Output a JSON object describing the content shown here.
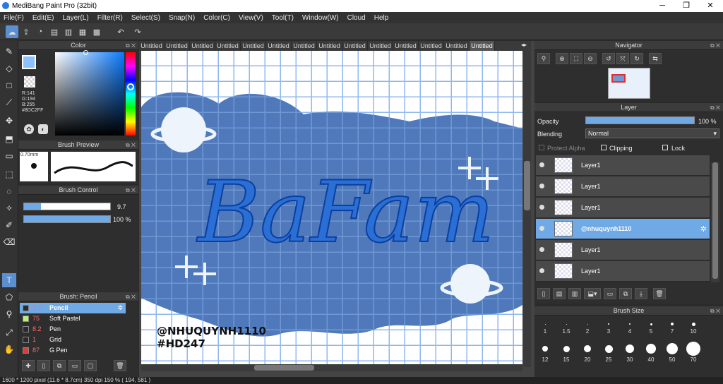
{
  "app": {
    "title": "MediBang Paint Pro (32bit)"
  },
  "window_controls": {
    "minimize": "─",
    "maximize": "❐",
    "close": "✕"
  },
  "menu": [
    "File(F)",
    "Edit(E)",
    "Layer(L)",
    "Filter(R)",
    "Select(S)",
    "Snap(N)",
    "Color(C)",
    "View(V)",
    "Tool(T)",
    "Window(W)",
    "Cloud",
    "Help"
  ],
  "tabs": [
    "Untitled",
    "Untitled",
    "Untitled",
    "Untitled",
    "Untitled",
    "Untitled",
    "Untitled",
    "Untitled",
    "Untitled",
    "Untitled",
    "Untitled",
    "Untitled",
    "Untitled",
    "Untitled"
  ],
  "color_panel": {
    "title": "Color",
    "r": "R:141",
    "g": "G:194",
    "b": "B:255",
    "hex": "#8DC2FF",
    "fg": "#8DC2FF",
    "bg": "#e05a2a"
  },
  "brush_preview": {
    "title": "Brush Preview",
    "size": "0.70mm"
  },
  "brush_control": {
    "title": "Brush Control",
    "size_value": "9.7",
    "size_fill": 0.2,
    "opacity_value": "100 %",
    "opacity_fill": 1.0
  },
  "brush_list": {
    "title": "Brush: Pencil",
    "items": [
      {
        "size": "9.7",
        "name": "Pencil",
        "color": "#2a2a2a"
      },
      {
        "size": "75",
        "name": "Soft Pastel",
        "color": "#b9f27a"
      },
      {
        "size": "8.2",
        "name": "Pen",
        "color": "#2a2a2a"
      },
      {
        "size": "1",
        "name": "Grid",
        "color": "#2a2a2a"
      },
      {
        "size": "87",
        "name": "G Pen",
        "color": "#e23b3b"
      }
    ]
  },
  "navigator": {
    "title": "Navigator"
  },
  "layer_panel": {
    "title": "Layer",
    "opacity_label": "Opacity",
    "opacity_value": "100 %",
    "opacity_fill": 1.0,
    "blending_label": "Blending",
    "blending_value": "Normal",
    "protect_alpha": "Protect Alpha",
    "clipping": "Clipping",
    "lock": "Lock",
    "layers": [
      "Layer1",
      "Layer1",
      "Layer1",
      "@nhuquynh1110",
      "Layer1",
      "Layer1"
    ],
    "active_index": 3
  },
  "brush_size": {
    "title": "Brush Size",
    "row1": [
      "1",
      "1.5",
      "2",
      "3",
      "4",
      "5",
      "7",
      "10"
    ],
    "row2": [
      "12",
      "15",
      "20",
      "25",
      "30",
      "40",
      "50",
      "70"
    ]
  },
  "artwork": {
    "main_text": "BaFam",
    "watermark_line1": "@NHUQUYNH1110",
    "watermark_line2": "#HD247"
  },
  "statusbar": {
    "text": "1600 * 1200 pixel   (11.6 * 8.7cm)   350 dpi   150 %   ( 194, 581 )"
  }
}
